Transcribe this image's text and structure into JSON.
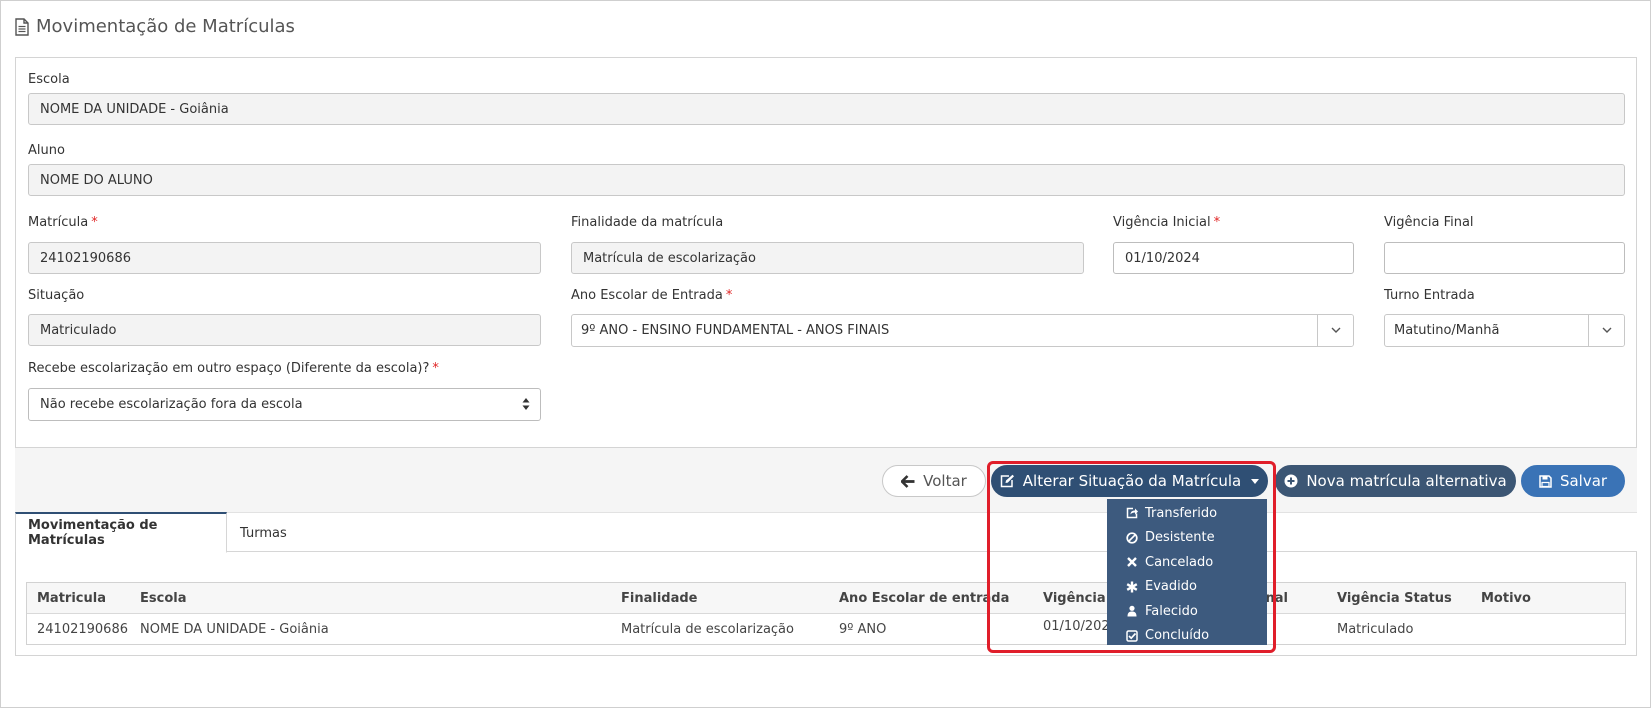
{
  "page": {
    "title": "Movimentação de Matrículas"
  },
  "form": {
    "escola": {
      "label": "Escola",
      "value": "NOME DA UNIDADE - Goiânia"
    },
    "aluno": {
      "label": "Aluno",
      "value": "NOME DO ALUNO"
    },
    "matricula": {
      "label": "Matrícula",
      "required": "*",
      "value": "24102190686"
    },
    "finalidade": {
      "label": "Finalidade da matrícula",
      "value": "Matrícula de escolarização"
    },
    "vigencia_inicial": {
      "label": "Vigência Inicial",
      "required": "*",
      "value": "01/10/2024"
    },
    "vigencia_final": {
      "label": "Vigência Final",
      "value": ""
    },
    "situacao": {
      "label": "Situação",
      "value": "Matriculado"
    },
    "ano_escolar": {
      "label": "Ano Escolar de Entrada",
      "required": "*",
      "value": "9º ANO - ENSINO FUNDAMENTAL - ANOS FINAIS"
    },
    "turno": {
      "label": "Turno Entrada",
      "value": "Matutino/Manhã"
    },
    "outro_espaco": {
      "label": "Recebe escolarização em outro espaço (Diferente da escola)?",
      "required": "*",
      "value": "Não recebe escolarização fora da escola"
    }
  },
  "actions": {
    "voltar": "Voltar",
    "alterar": "Alterar Situação da Matrícula",
    "nova": "Nova matrícula alternativa",
    "salvar": "Salvar"
  },
  "dropdown": {
    "items": [
      {
        "label": "Transferido",
        "icon": "share-icon"
      },
      {
        "label": "Desistente",
        "icon": "ban-icon"
      },
      {
        "label": "Cancelado",
        "icon": "times-icon"
      },
      {
        "label": "Evadido",
        "icon": "asterisk-icon"
      },
      {
        "label": "Falecido",
        "icon": "user-icon"
      },
      {
        "label": "Concluído",
        "icon": "check-square-icon"
      }
    ]
  },
  "tabs": [
    {
      "label": "Movimentação de Matrículas",
      "active": true
    },
    {
      "label": "Turmas",
      "active": false
    }
  ],
  "table": {
    "headers": [
      "Matricula",
      "Escola",
      "Finalidade",
      "Ano Escolar de entrada",
      "Vigência In",
      "inal",
      "Vigência Status",
      "Motivo"
    ],
    "rows": [
      [
        "24102190686",
        "NOME DA UNIDADE - Goiânia",
        "Matrícula de escolarização",
        "9º ANO",
        "01/10/2024",
        "",
        "Matriculado",
        ""
      ]
    ]
  },
  "colors": {
    "primary_dark": "#2f4f74",
    "primary": "#3a73b6",
    "dropdown_bg": "#3d5a7e",
    "highlight": "#e01e2a",
    "required": "#e02424"
  }
}
